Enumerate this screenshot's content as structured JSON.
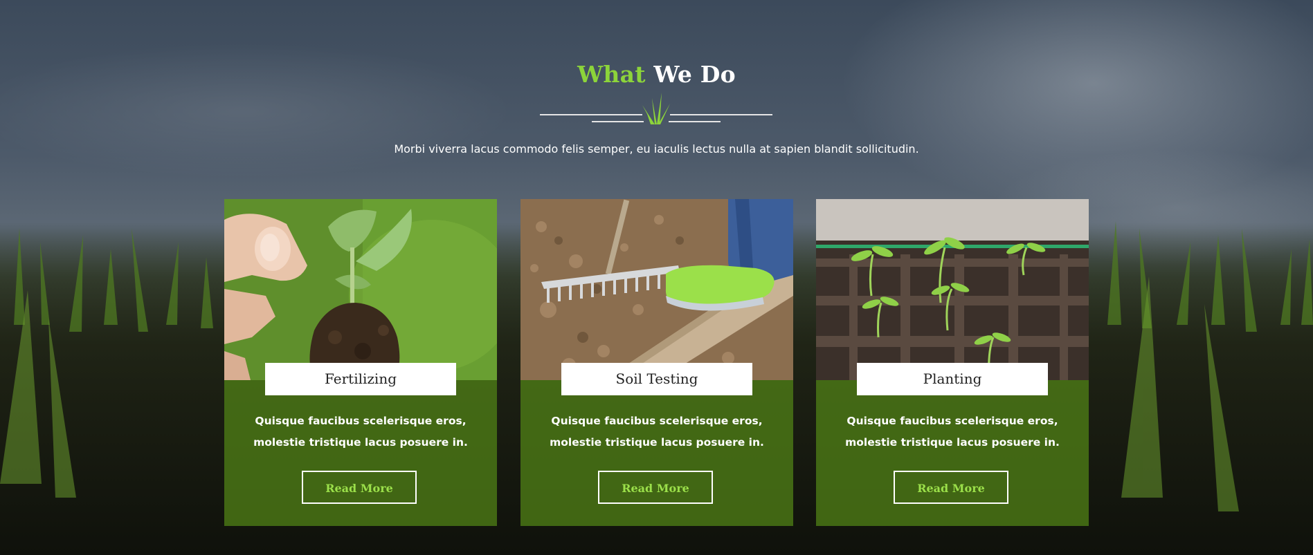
{
  "section": {
    "title_accent": "What",
    "title_rest": "We Do",
    "subtitle": "Morbi viverra lacus commodo felis semper, eu iaculis lectus nulla at sapien blandit sollicitudin."
  },
  "colors": {
    "accent": "#8cd43a",
    "card_overlay": "#4e7d16",
    "button_text": "#9be04a",
    "label_background": "#ffffff"
  },
  "cards": [
    {
      "title": "Fertilizing",
      "text": "Quisque faucibus scelerisque eros, molestie tristique lacus posuere in.",
      "button": "Read More",
      "image": "hand-holding-seedling-photo"
    },
    {
      "title": "Soil Testing",
      "text": "Quisque faucibus scelerisque eros, molestie tristique lacus posuere in.",
      "button": "Read More",
      "image": "rake-and-green-boot-photo"
    },
    {
      "title": "Planting",
      "text": "Quisque faucibus scelerisque eros, molestie tristique lacus posuere in.",
      "button": "Read More",
      "image": "seedling-tray-photo"
    }
  ]
}
